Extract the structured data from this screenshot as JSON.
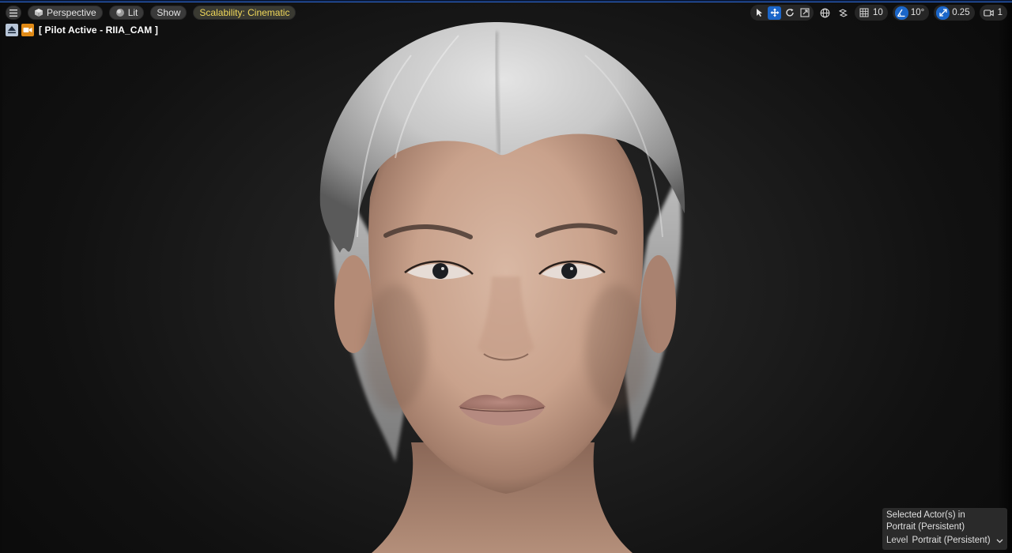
{
  "toolbar": {
    "view_mode": "Perspective",
    "lighting": "Lit",
    "show": "Show",
    "scalability": "Scalability: Cinematic"
  },
  "transform_toolbar": {
    "grid_snap": "10",
    "rotation_snap": "10°",
    "scale_snap": "0.25",
    "camera_speed": "1"
  },
  "pilot": {
    "label": "[ Pilot Active - RIIA_CAM ]"
  },
  "selection": {
    "line1": "Selected Actor(s) in",
    "line2": "Portrait (Persistent)",
    "level_label": "Level",
    "level_value": "Portrait (Persistent)"
  },
  "colors": {
    "accent": "#1b66c9",
    "scalability_text": "#f1d85a",
    "camera_icon": "#e08a16"
  }
}
